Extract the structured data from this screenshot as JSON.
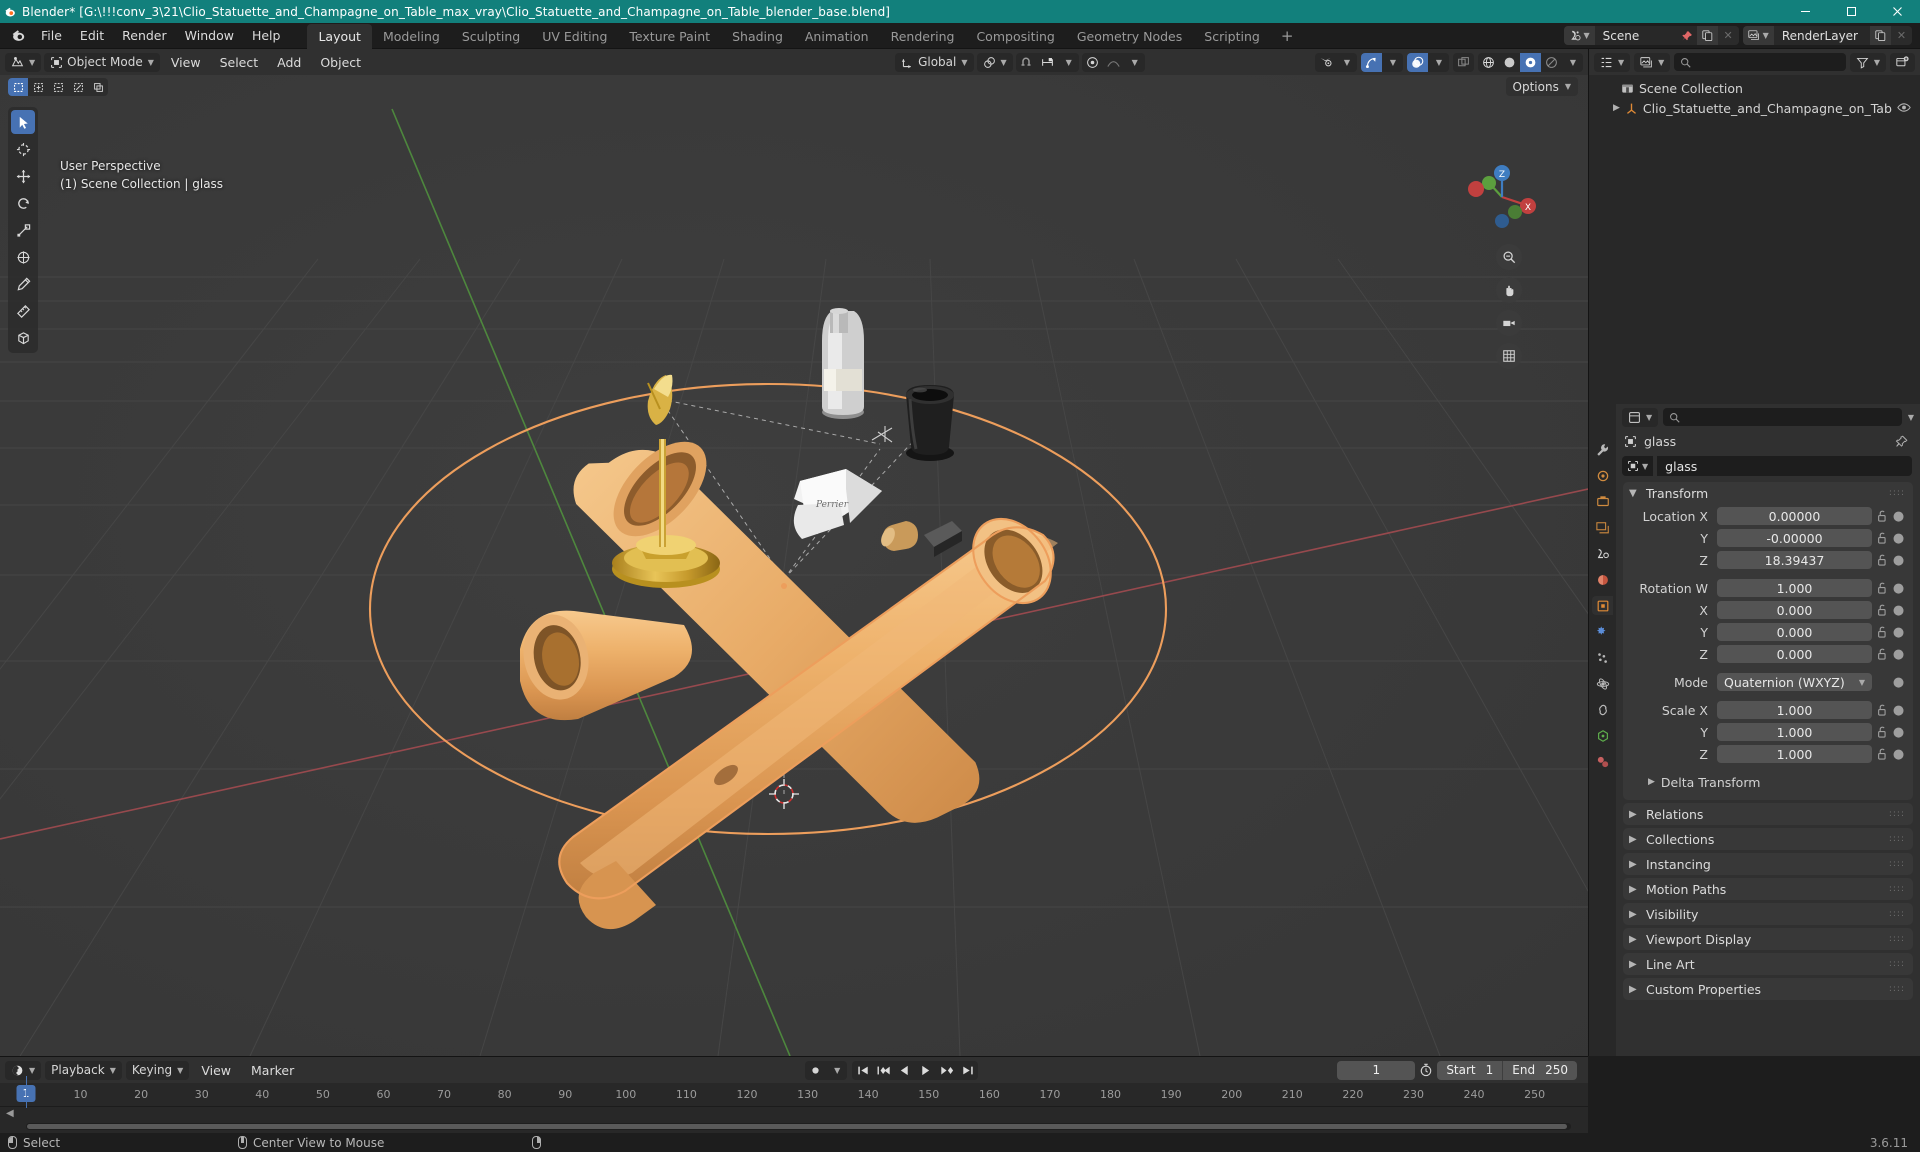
{
  "window": {
    "title": "Blender* [G:\\!!!conv_3\\21\\Clio_Statuette_and_Champagne_on_Table_max_vray\\Clio_Statuette_and_Champagne_on_Table_blender_base.blend]",
    "minimize": "—",
    "maximize": "❐",
    "close": "✕"
  },
  "topbar": {
    "menus": [
      "File",
      "Edit",
      "Render",
      "Window",
      "Help"
    ],
    "workspaces": [
      {
        "label": "Layout",
        "active": true
      },
      {
        "label": "Modeling",
        "active": false
      },
      {
        "label": "Sculpting",
        "active": false
      },
      {
        "label": "UV Editing",
        "active": false
      },
      {
        "label": "Texture Paint",
        "active": false
      },
      {
        "label": "Shading",
        "active": false
      },
      {
        "label": "Animation",
        "active": false
      },
      {
        "label": "Rendering",
        "active": false
      },
      {
        "label": "Compositing",
        "active": false
      },
      {
        "label": "Geometry Nodes",
        "active": false
      },
      {
        "label": "Scripting",
        "active": false
      }
    ],
    "add_workspace": "+",
    "scene_name": "Scene",
    "viewlayer_name": "RenderLayer"
  },
  "viewport": {
    "mode": "Object Mode",
    "menus": [
      "View",
      "Select",
      "Add",
      "Object"
    ],
    "transform_orientation": "Global",
    "options_label": "Options",
    "overlay_line1": "User Perspective",
    "overlay_line2": "(1) Scene Collection | glass",
    "tools": [
      "tweak-select-tool",
      "cursor-tool",
      "move-tool",
      "rotate-tool",
      "scale-tool",
      "transform-tool",
      "annotate-tool",
      "measure-tool",
      "add-cube-tool"
    ]
  },
  "outliner": {
    "display_mode": "View Layer",
    "search_placeholder": "",
    "rows": [
      {
        "label": "Scene Collection",
        "indent": 0,
        "icon": "collection-icon",
        "expandable": false
      },
      {
        "label": "Clio_Statuette_and_Champagne_on_Tab",
        "indent": 1,
        "icon": "empty-axis-icon",
        "expandable": true
      }
    ]
  },
  "properties": {
    "breadcrumb_object": "glass",
    "object_name": "glass",
    "tabs": [
      "tool-tab",
      "render-tab",
      "output-tab",
      "view-layer-tab",
      "scene-tab",
      "world-tab",
      "object-tab",
      "modifiers-tab",
      "particles-tab",
      "physics-tab",
      "constraints-tab",
      "object-data-tab",
      "material-tab"
    ],
    "transform": {
      "title": "Transform",
      "rows": [
        {
          "label": "Location X",
          "value": "0.00000"
        },
        {
          "label": "Y",
          "value": "-0.00000"
        },
        {
          "label": "Z",
          "value": "18.39437"
        }
      ],
      "rotation": [
        {
          "label": "Rotation W",
          "value": "1.000"
        },
        {
          "label": "X",
          "value": "0.000"
        },
        {
          "label": "Y",
          "value": "0.000"
        },
        {
          "label": "Z",
          "value": "0.000"
        }
      ],
      "mode_label": "Mode",
      "mode_value": "Quaternion (WXYZ)",
      "scale": [
        {
          "label": "Scale X",
          "value": "1.000"
        },
        {
          "label": "Y",
          "value": "1.000"
        },
        {
          "label": "Z",
          "value": "1.000"
        }
      ],
      "delta_transform": "Delta Transform"
    },
    "panels": [
      "Relations",
      "Collections",
      "Instancing",
      "Motion Paths",
      "Visibility",
      "Viewport Display",
      "Line Art",
      "Custom Properties"
    ]
  },
  "timeline": {
    "menus": [
      "Playback",
      "Keying",
      "View",
      "Marker"
    ],
    "current_frame": "1",
    "start_label": "Start",
    "start_value": "1",
    "end_label": "End",
    "end_value": "250",
    "ticks": [
      10,
      20,
      30,
      40,
      50,
      60,
      70,
      80,
      90,
      100,
      110,
      120,
      130,
      140,
      150,
      160,
      170,
      180,
      190,
      200,
      210,
      220,
      230,
      240,
      250
    ],
    "playhead_frame": "1"
  },
  "statusbar": {
    "items": [
      {
        "mouse": "left",
        "label": "Select"
      },
      {
        "mouse": "middle",
        "label": "Center View to Mouse"
      },
      {
        "mouse": "right",
        "label": ""
      }
    ],
    "version": "3.6.11"
  },
  "colors": {
    "title_bg": "#12807c",
    "accent_blue": "#4772b3",
    "selection_orange": "#ed9e5c",
    "header_bg": "#303030",
    "panel_bg": "#383838",
    "editor_bg": "#282828",
    "viewport_bg": "#393939"
  }
}
